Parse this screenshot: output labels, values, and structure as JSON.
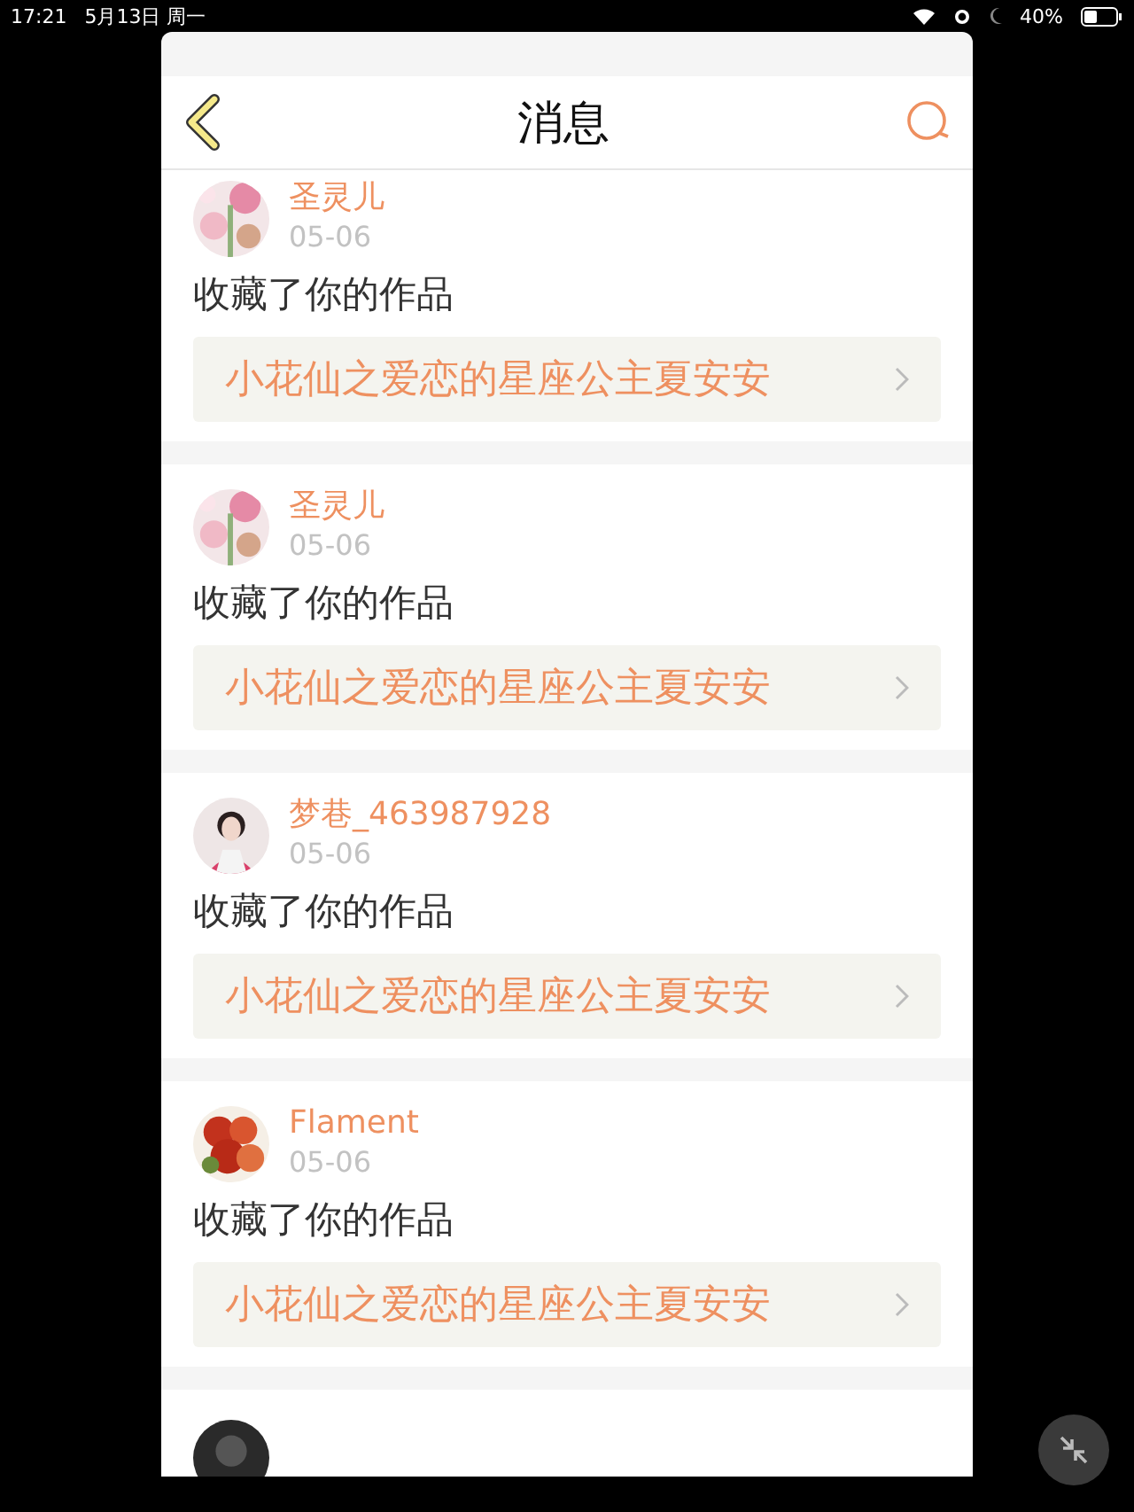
{
  "status_bar": {
    "time": "17:21",
    "date": "5月13日 周一",
    "battery_text": "40%"
  },
  "header": {
    "title": "消息"
  },
  "items": [
    {
      "user": "圣灵儿",
      "date": "05-06",
      "action": "收藏了你的作品",
      "work": "小花仙之爱恋的星座公主夏安安"
    },
    {
      "user": "圣灵儿",
      "date": "05-06",
      "action": "收藏了你的作品",
      "work": "小花仙之爱恋的星座公主夏安安"
    },
    {
      "user": "梦巷_463987928",
      "date": "05-06",
      "action": "收藏了你的作品",
      "work": "小花仙之爱恋的星座公主夏安安"
    },
    {
      "user": "Flament",
      "date": "05-06",
      "action": "收藏了你的作品",
      "work": "小花仙之爱恋的星座公主夏安安"
    }
  ],
  "next_item_peek": true
}
